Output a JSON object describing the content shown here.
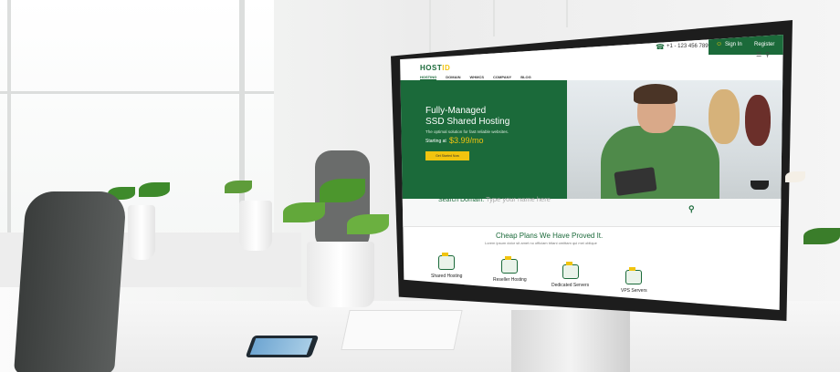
{
  "site": {
    "logo_main": "HOST",
    "logo_accent": "ID",
    "phone": "+1 - 123 456 7899",
    "sign_in": "Sign In",
    "register": "Register",
    "nav": [
      "HOSTING",
      "DOMAIN",
      "WHMCS",
      "COMPANY",
      "BLOG"
    ],
    "hero": {
      "title_line1": "Fully-Managed",
      "title_line2": "SSD Shared Hosting",
      "subtitle": "The optimal solution for fast reliable websites.",
      "price_label": "Starting at",
      "price": "$3.99/mo",
      "cta": "Get Started Now"
    },
    "search": {
      "label": "Search Domain:",
      "placeholder": "Type your name here"
    },
    "plans": {
      "title": "Cheap Plans We Have Proved It.",
      "subtitle": "Lorem ipsum dolor sit amet no officiam tritani omittam qui mei oblique",
      "items": [
        "Shared Hosting",
        "Reseller Hosting",
        "Dedicated Servers",
        "VPS Servers"
      ]
    }
  },
  "icons": {
    "phone": "phone-icon",
    "user": "user-icon",
    "menu": "menu-icon",
    "search": "search-icon"
  },
  "colors": {
    "brand_green": "#1b6a3a",
    "accent_yellow": "#f1c40f"
  }
}
